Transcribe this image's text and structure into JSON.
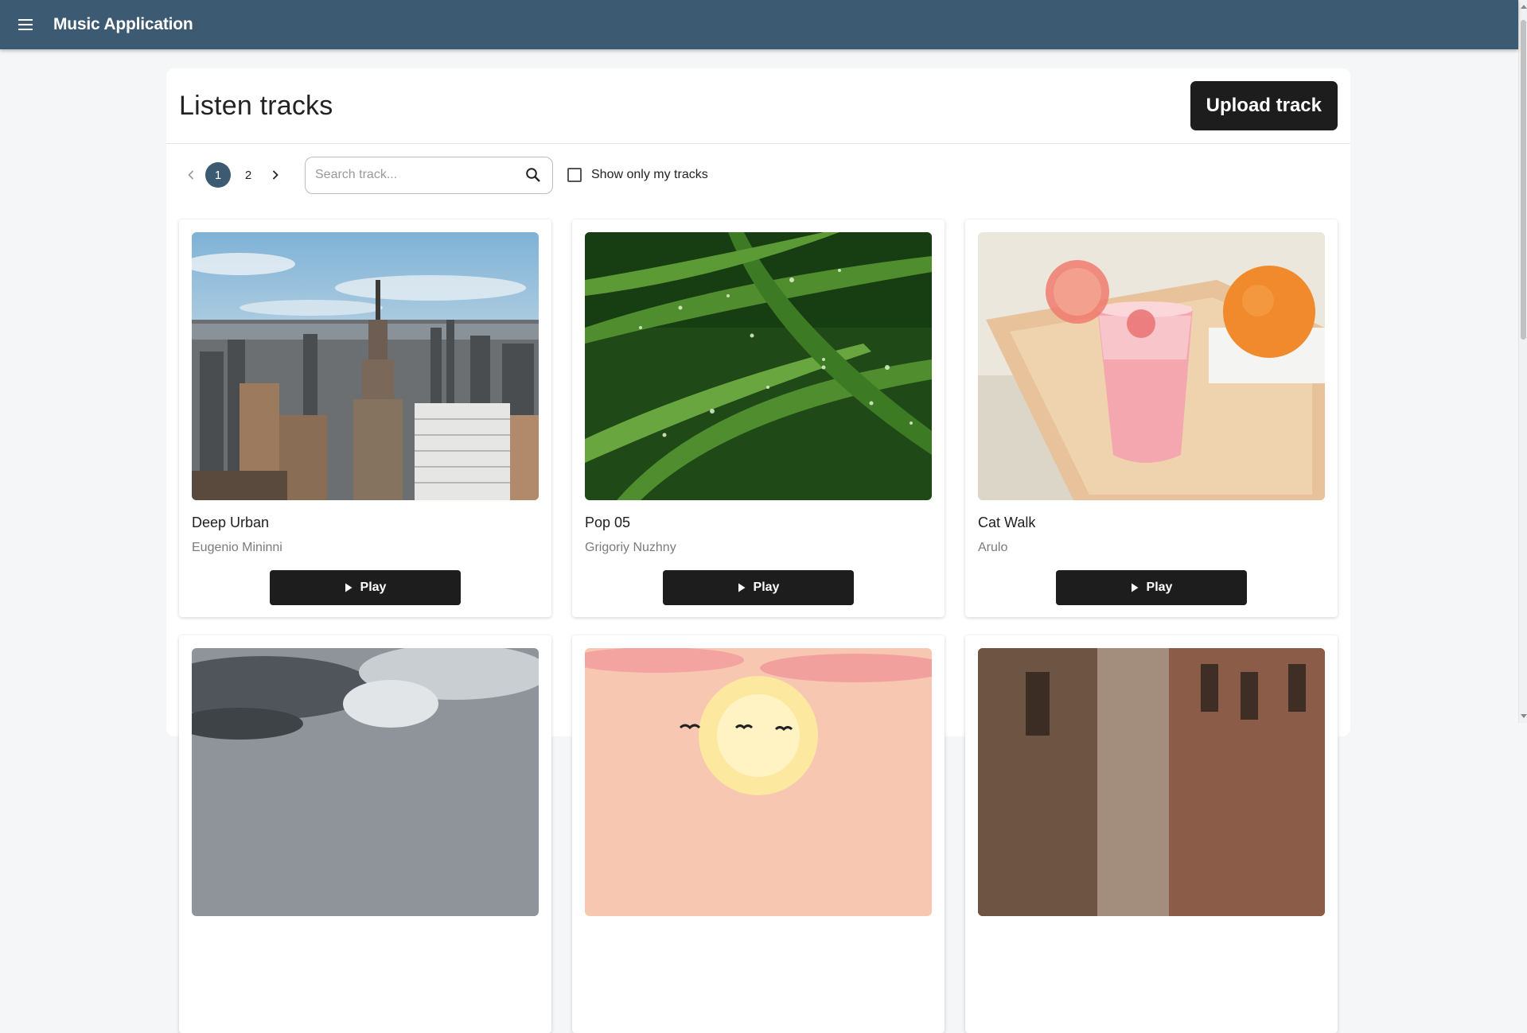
{
  "app": {
    "title": "Music Application"
  },
  "header": {
    "title": "Listen tracks",
    "upload_label": "Upload track"
  },
  "pagination": {
    "prev": "‹",
    "next": "›",
    "pages": [
      "1",
      "2"
    ],
    "current": "1"
  },
  "search": {
    "placeholder": "Search track...",
    "value": ""
  },
  "filter": {
    "label": "Show only my tracks",
    "checked": false
  },
  "tracks": [
    {
      "title": "Deep Urban",
      "artist": "Eugenio Mininni",
      "play_label": "Play",
      "cover": "city-skyline"
    },
    {
      "title": "Pop 05",
      "artist": "Grigoriy Nuzhny",
      "play_label": "Play",
      "cover": "grass-dew"
    },
    {
      "title": "Cat Walk",
      "artist": "Arulo",
      "play_label": "Play",
      "cover": "grapefruit-drink"
    },
    {
      "cover": "stormy-clouds"
    },
    {
      "cover": "sunset-illustration"
    },
    {
      "cover": "old-street"
    }
  ],
  "colors": {
    "appbar": "#3d5a73",
    "button": "#1d1d1d",
    "active_page": "#3d5a73"
  }
}
